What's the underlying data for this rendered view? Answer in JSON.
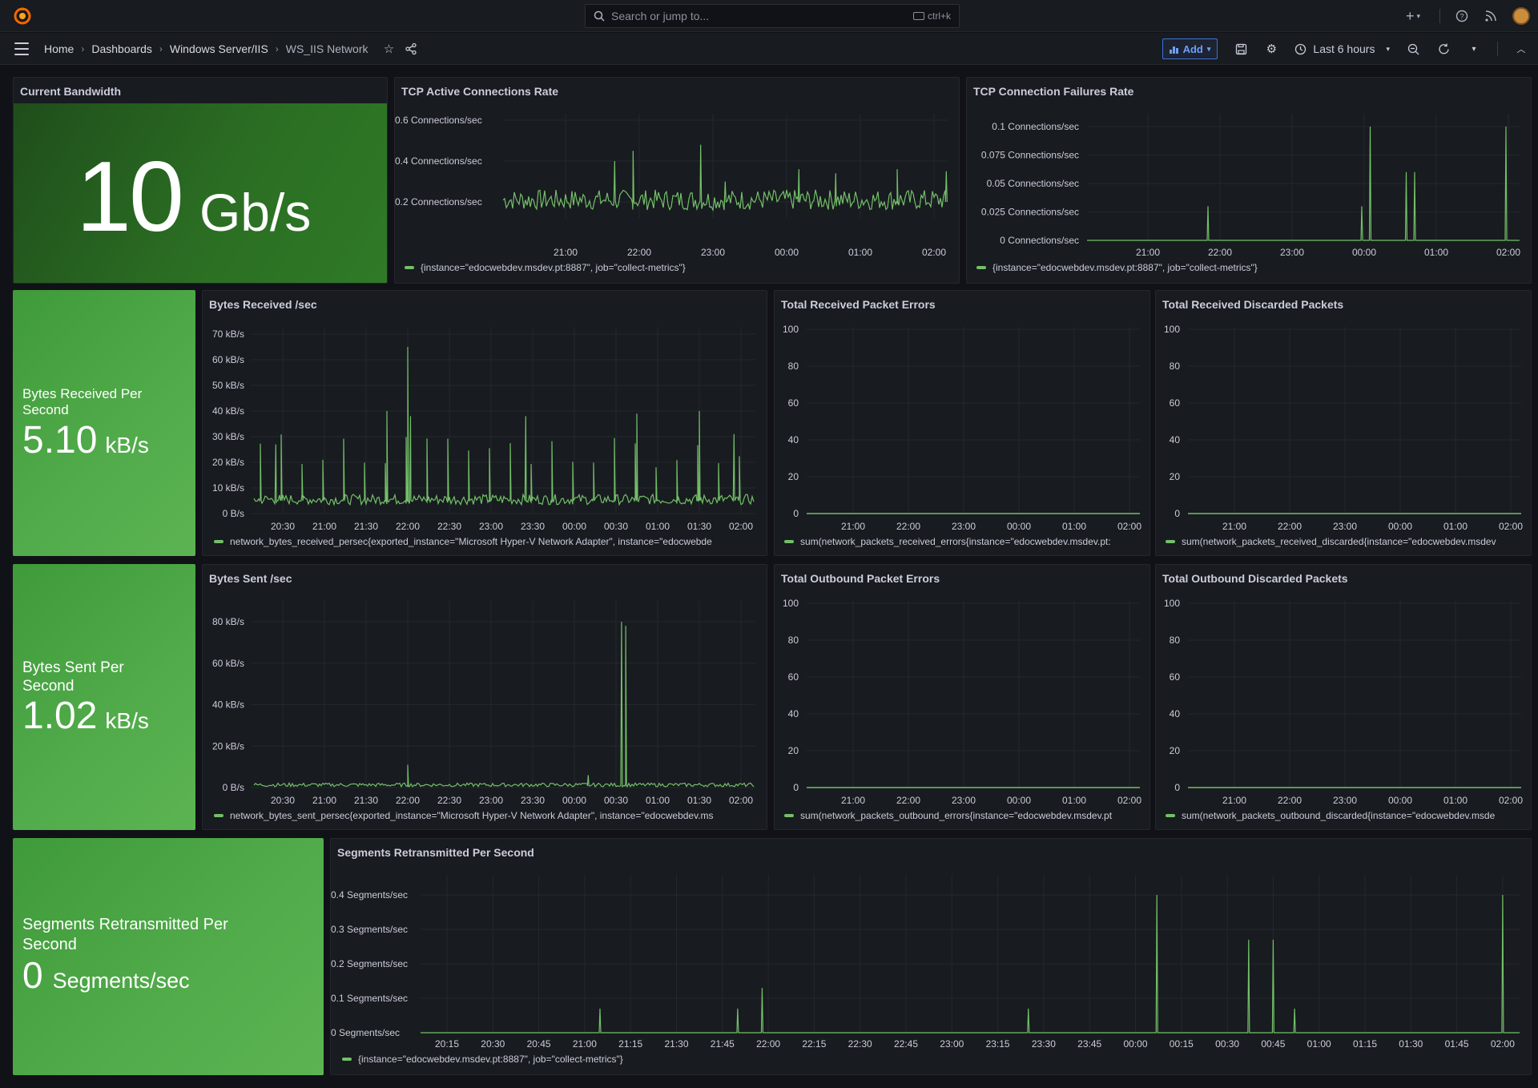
{
  "topbar": {
    "search_placeholder": "Search or jump to...",
    "shortcut": "ctrl+k",
    "plus_label": "+"
  },
  "breadcrumb": [
    "Home",
    "Dashboards",
    "Windows Server/IIS",
    "WS_IIS Network"
  ],
  "toolbar": {
    "add_label": "Add",
    "time_range": "Last 6 hours"
  },
  "colors": {
    "accent": "#73bf69",
    "stat_dark": "#2a6b23",
    "stat_green": "#4ca64a",
    "bg": "#111217",
    "panel": "#181b1f"
  },
  "panels": {
    "bandwidth": {
      "title": "Current Bandwidth",
      "value": "10",
      "unit": "Gb/s"
    },
    "tcp_active": {
      "title": "TCP Active Connections Rate",
      "yticks": [
        "0.6 Connections/sec",
        "0.4 Connections/sec",
        "0.2 Connections/sec"
      ],
      "xticks": [
        "21:00",
        "22:00",
        "23:00",
        "00:00",
        "01:00",
        "02:00"
      ],
      "legend": "{instance=\"edocwebdev.msdev.pt:8887\", job=\"collect-metrics\"}"
    },
    "tcp_fail": {
      "title": "TCP Connection Failures Rate",
      "yticks": [
        "0.1 Connections/sec",
        "0.075 Connections/sec",
        "0.05 Connections/sec",
        "0.025 Connections/sec",
        "0 Connections/sec"
      ],
      "xticks": [
        "21:00",
        "22:00",
        "23:00",
        "00:00",
        "01:00",
        "02:00"
      ],
      "legend": "{instance=\"edocwebdev.msdev.pt:8887\", job=\"collect-metrics\"}"
    },
    "bytes_recv_stat": {
      "label": "Bytes Received Per Second",
      "value": "5.10",
      "unit": "kB/s"
    },
    "bytes_recv": {
      "title": "Bytes Received /sec",
      "yticks": [
        "70 kB/s",
        "60 kB/s",
        "50 kB/s",
        "40 kB/s",
        "30 kB/s",
        "20 kB/s",
        "10 kB/s",
        "0 B/s"
      ],
      "xticks": [
        "20:30",
        "21:00",
        "21:30",
        "22:00",
        "22:30",
        "23:00",
        "23:30",
        "00:00",
        "00:30",
        "01:00",
        "01:30",
        "02:00"
      ],
      "legend": "network_bytes_received_persec{exported_instance=\"Microsoft Hyper-V Network Adapter\", instance=\"edocwebde"
    },
    "recv_errors": {
      "title": "Total Received Packet Errors",
      "yticks": [
        "100",
        "80",
        "60",
        "40",
        "20",
        "0"
      ],
      "xticks": [
        "21:00",
        "22:00",
        "23:00",
        "00:00",
        "01:00",
        "02:00"
      ],
      "legend": "sum(network_packets_received_errors{instance=\"edocwebdev.msdev.pt:"
    },
    "recv_discarded": {
      "title": "Total Received Discarded Packets",
      "yticks": [
        "100",
        "80",
        "60",
        "40",
        "20",
        "0"
      ],
      "xticks": [
        "21:00",
        "22:00",
        "23:00",
        "00:00",
        "01:00",
        "02:00"
      ],
      "legend": "sum(network_packets_received_discarded{instance=\"edocwebdev.msdev"
    },
    "bytes_sent_stat": {
      "label": "Bytes Sent Per Second",
      "value": "1.02",
      "unit": "kB/s"
    },
    "bytes_sent": {
      "title": "Bytes Sent /sec",
      "yticks": [
        "80 kB/s",
        "60 kB/s",
        "40 kB/s",
        "20 kB/s",
        "0 B/s"
      ],
      "xticks": [
        "20:30",
        "21:00",
        "21:30",
        "22:00",
        "22:30",
        "23:00",
        "23:30",
        "00:00",
        "00:30",
        "01:00",
        "01:30",
        "02:00"
      ],
      "legend": "network_bytes_sent_persec{exported_instance=\"Microsoft Hyper-V Network Adapter\", instance=\"edocwebdev.ms"
    },
    "out_errors": {
      "title": "Total Outbound Packet Errors",
      "yticks": [
        "100",
        "80",
        "60",
        "40",
        "20",
        "0"
      ],
      "xticks": [
        "21:00",
        "22:00",
        "23:00",
        "00:00",
        "01:00",
        "02:00"
      ],
      "legend": "sum(network_packets_outbound_errors{instance=\"edocwebdev.msdev.pt"
    },
    "out_discarded": {
      "title": "Total Outbound Discarded Packets",
      "yticks": [
        "100",
        "80",
        "60",
        "40",
        "20",
        "0"
      ],
      "xticks": [
        "21:00",
        "22:00",
        "23:00",
        "00:00",
        "01:00",
        "02:00"
      ],
      "legend": "sum(network_packets_outbound_discarded{instance=\"edocwebdev.msde"
    },
    "seg_stat": {
      "label": "Segments Retransmitted Per Second",
      "value": "0",
      "unit": "Segments/sec"
    },
    "seg_retx": {
      "title": "Segments Retransmitted Per Second",
      "yticks": [
        "0.4 Segments/sec",
        "0.3 Segments/sec",
        "0.2 Segments/sec",
        "0.1 Segments/sec",
        "0 Segments/sec"
      ],
      "xticks": [
        "20:15",
        "20:30",
        "20:45",
        "21:00",
        "21:15",
        "21:30",
        "21:45",
        "22:00",
        "22:15",
        "22:30",
        "22:45",
        "23:00",
        "23:15",
        "23:30",
        "23:45",
        "00:00",
        "00:15",
        "00:30",
        "00:45",
        "01:00",
        "01:15",
        "01:30",
        "01:45",
        "02:00"
      ],
      "legend": "{instance=\"edocwebdev.msdev.pt:8887\", job=\"collect-metrics\"}"
    }
  },
  "chart_data": [
    {
      "type": "line",
      "title": "TCP Active Connections Rate",
      "ylim": [
        0.1,
        0.6
      ],
      "series": [
        {
          "values": [
            0.18,
            0.2,
            0.22,
            0.18,
            0.2,
            0.21,
            0.19,
            0.2,
            0.22,
            0.18,
            0.2,
            0.19,
            0.21,
            0.2,
            0.18,
            0.22,
            0.2,
            0.19,
            0.21,
            0.2
          ]
        }
      ],
      "spikes": [
        {
          "x": "21:40",
          "y": 0.4
        },
        {
          "x": "21:55",
          "y": 0.45
        },
        {
          "x": "22:50",
          "y": 0.48
        },
        {
          "x": "23:10",
          "y": 0.3
        },
        {
          "x": "00:10",
          "y": 0.36
        },
        {
          "x": "00:40",
          "y": 0.34
        },
        {
          "x": "01:30",
          "y": 0.36
        },
        {
          "x": "02:10",
          "y": 0.35
        }
      ]
    },
    {
      "type": "line",
      "title": "TCP Connection Failures Rate",
      "ylim": [
        0,
        0.1
      ],
      "spikes": [
        {
          "x": "21:50",
          "y": 0.03
        },
        {
          "x": "23:58",
          "y": 0.03
        },
        {
          "x": "00:05",
          "y": 0.1
        },
        {
          "x": "00:35",
          "y": 0.06
        },
        {
          "x": "00:42",
          "y": 0.06
        },
        {
          "x": "01:58",
          "y": 0.1
        }
      ]
    },
    {
      "type": "line",
      "title": "Bytes Received /sec",
      "ylim": [
        0,
        70000
      ],
      "baseline": 5000,
      "spikes": [
        {
          "x": "20:25",
          "y": 27000
        },
        {
          "x": "21:45",
          "y": 40000
        },
        {
          "x": "22:00",
          "y": 65000
        },
        {
          "x": "22:02",
          "y": 38000
        },
        {
          "x": "23:25",
          "y": 38000
        },
        {
          "x": "00:45",
          "y": 39000
        },
        {
          "x": "01:30",
          "y": 40000
        },
        {
          "x": "01:55",
          "y": 31000
        }
      ]
    },
    {
      "type": "line",
      "title": "Bytes Sent /sec",
      "ylim": [
        0,
        80000
      ],
      "baseline": 1000,
      "spikes": [
        {
          "x": "22:00",
          "y": 11000
        },
        {
          "x": "00:10",
          "y": 6000
        },
        {
          "x": "00:34",
          "y": 80000
        },
        {
          "x": "00:37",
          "y": 78000
        }
      ]
    },
    {
      "type": "line",
      "title": "Total Received Packet Errors",
      "ylim": [
        0,
        100
      ],
      "series": [
        {
          "values": [
            0,
            0
          ]
        }
      ]
    },
    {
      "type": "line",
      "title": "Total Received Discarded Packets",
      "ylim": [
        0,
        100
      ],
      "series": [
        {
          "values": [
            0,
            0
          ]
        }
      ]
    },
    {
      "type": "line",
      "title": "Total Outbound Packet Errors",
      "ylim": [
        0,
        100
      ],
      "series": [
        {
          "values": [
            0,
            0
          ]
        }
      ]
    },
    {
      "type": "line",
      "title": "Total Outbound Discarded Packets",
      "ylim": [
        0,
        100
      ],
      "series": [
        {
          "values": [
            0,
            0
          ]
        }
      ]
    },
    {
      "type": "line",
      "title": "Segments Retransmitted Per Second",
      "ylim": [
        0,
        0.4
      ],
      "spikes": [
        {
          "x": "21:05",
          "y": 0.07
        },
        {
          "x": "21:50",
          "y": 0.07
        },
        {
          "x": "21:58",
          "y": 0.13
        },
        {
          "x": "23:25",
          "y": 0.07
        },
        {
          "x": "00:07",
          "y": 0.4
        },
        {
          "x": "00:37",
          "y": 0.27
        },
        {
          "x": "00:45",
          "y": 0.27
        },
        {
          "x": "00:52",
          "y": 0.07
        },
        {
          "x": "02:00",
          "y": 0.4
        }
      ]
    }
  ]
}
